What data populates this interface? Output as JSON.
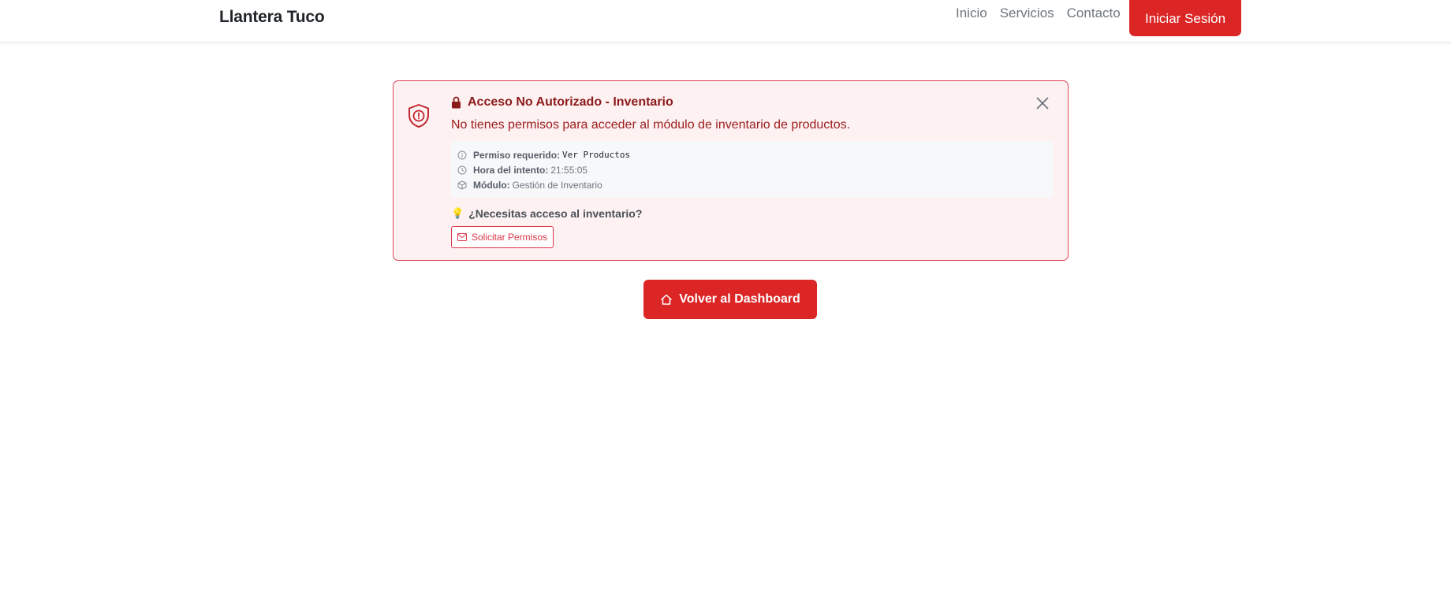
{
  "navbar": {
    "brand": "Llantera Tuco",
    "links": [
      "Inicio",
      "Servicios",
      "Contacto"
    ],
    "login_label": "Iniciar Sesión"
  },
  "alert": {
    "title": "Acceso No Autorizado - Inventario",
    "message": "No tienes permisos para acceder al módulo de inventario de productos.",
    "details": {
      "permission_label": "Permiso requerido:",
      "permission_value": "Ver Productos",
      "time_label": "Hora del intento:",
      "time_value": "21:55:05",
      "module_label": "Módulo:",
      "module_value": "Gestión de Inventario"
    },
    "help_text": "¿Necesitas acceso al inventario?",
    "request_button": "Solicitar Permisos"
  },
  "dashboard_button": "Volver al Dashboard",
  "colors": {
    "primary_red": "#dc2626",
    "alert_bg": "#fef1f2",
    "alert_border": "#e0445a",
    "alert_text": "#9b1c1c"
  }
}
